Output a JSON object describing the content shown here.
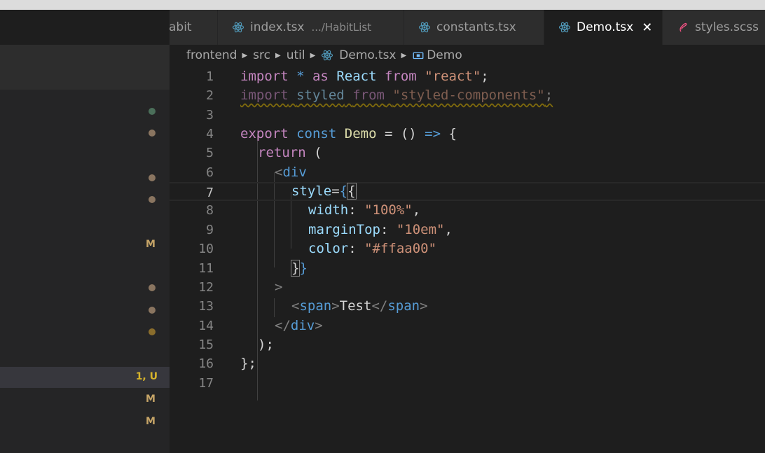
{
  "tabs": [
    {
      "label": "abit",
      "description": ""
    },
    {
      "label": "index.tsx",
      "description": ".../HabitList"
    },
    {
      "label": "constants.tsx",
      "description": ""
    },
    {
      "label": "Demo.tsx",
      "description": "",
      "active": true
    },
    {
      "label": "styles.scss",
      "description": ""
    }
  ],
  "breadcrumb": {
    "part1": "frontend",
    "part2": "src",
    "part3": "util",
    "file": "Demo.tsx",
    "symbol": "Demo"
  },
  "sidebar": {
    "statuses": [
      "M",
      "1, U",
      "M",
      "M"
    ],
    "dot_colors": [
      "#4b6f5a",
      "#8a7560",
      "#8a7560",
      "#8a7560",
      "#8a7560",
      "#8a7560",
      "#8a6d2c"
    ]
  },
  "editor": {
    "current_line": 7,
    "line_numbers": [
      "1",
      "2",
      "3",
      "4",
      "5",
      "6",
      "7",
      "8",
      "9",
      "10",
      "11",
      "12",
      "13",
      "14",
      "15",
      "16",
      "17"
    ],
    "tokens": {
      "l1": [
        "import",
        " * ",
        "as",
        " ",
        "React",
        " ",
        "from",
        " ",
        "\"react\"",
        ";"
      ],
      "l2": [
        "import",
        " ",
        "styled",
        " ",
        "from",
        " ",
        "\"styled-components\"",
        ";"
      ],
      "l4": [
        "export",
        " ",
        "const",
        " ",
        "Demo",
        " = () ",
        "=>",
        " {"
      ],
      "l5": [
        "return",
        " ("
      ],
      "l6": [
        "<",
        "div"
      ],
      "l7": [
        "style",
        "=",
        "{",
        "{"
      ],
      "l8": [
        "width",
        ": ",
        "\"100%\"",
        ","
      ],
      "l9": [
        "marginTop",
        ": ",
        "\"10em\"",
        ","
      ],
      "l10": [
        "color",
        ": ",
        "\"#ffaa00\""
      ],
      "l11": [
        "}",
        "}"
      ],
      "l12": [
        ">"
      ],
      "l13": [
        "<",
        "span",
        ">",
        "Test",
        "</",
        "span",
        ">"
      ],
      "l14": [
        "</",
        "div",
        ">"
      ],
      "l15": [
        ");"
      ],
      "l16": [
        "};"
      ]
    }
  }
}
